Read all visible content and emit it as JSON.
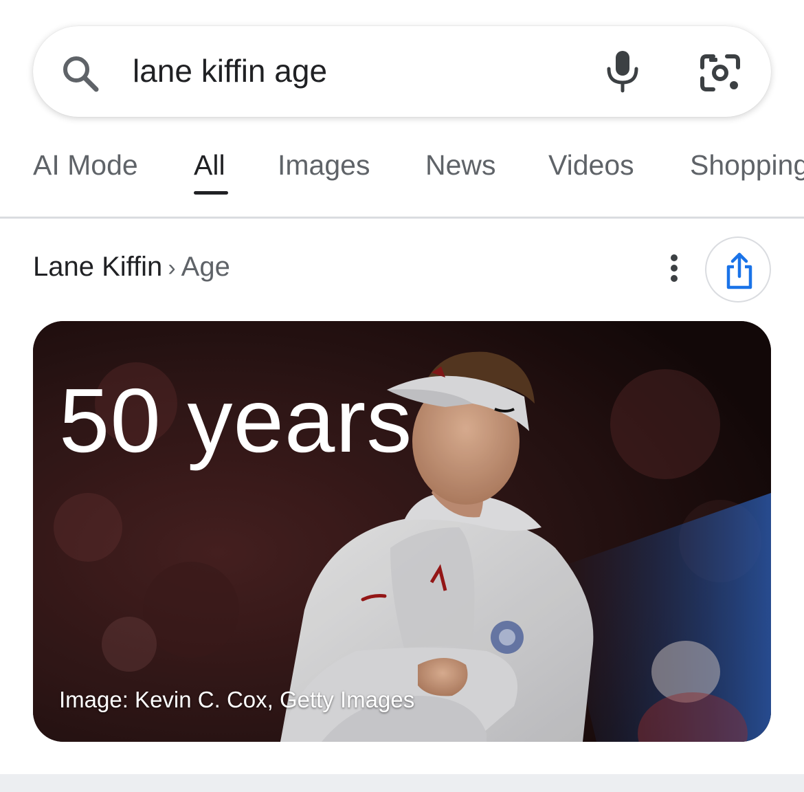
{
  "search": {
    "query": "lane kiffin age",
    "icons": [
      "search-icon",
      "mic-icon",
      "lens-icon"
    ]
  },
  "tabs": [
    {
      "label": "AI Mode",
      "active": false
    },
    {
      "label": "All",
      "active": true
    },
    {
      "label": "Images",
      "active": false
    },
    {
      "label": "News",
      "active": false
    },
    {
      "label": "Videos",
      "active": false
    },
    {
      "label": "Shopping",
      "active": false
    }
  ],
  "answer": {
    "breadcrumb_entity": "Lane Kiffin",
    "breadcrumb_separator": "›",
    "breadcrumb_attribute": "Age",
    "value": "50 years",
    "image_credit": "Image: Kevin C. Cox, Getty Images",
    "icons": [
      "more-vert-icon",
      "share-icon"
    ]
  },
  "colors": {
    "accent_blue": "#1a73e8",
    "text_primary": "#202124",
    "text_secondary": "#5f6368",
    "divider": "#dadce0"
  }
}
